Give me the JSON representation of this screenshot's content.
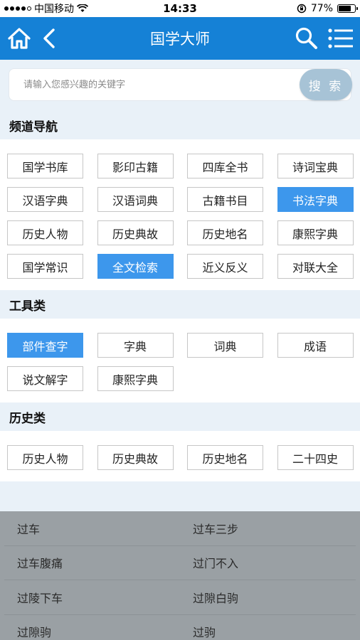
{
  "status_bar": {
    "carrier": "中国移动",
    "time": "14:33",
    "battery_text": "77%",
    "battery_level": 0.77
  },
  "header": {
    "title": "国学大师"
  },
  "search": {
    "placeholder": "请输入您感兴趣的关键字",
    "button_label": "搜 索"
  },
  "sections": [
    {
      "title": "频道导航",
      "items": [
        {
          "label": "国学书库",
          "active": false
        },
        {
          "label": "影印古籍",
          "active": false
        },
        {
          "label": "四库全书",
          "active": false
        },
        {
          "label": "诗词宝典",
          "active": false
        },
        {
          "label": "汉语字典",
          "active": false
        },
        {
          "label": "汉语词典",
          "active": false
        },
        {
          "label": "古籍书目",
          "active": false
        },
        {
          "label": "书法字典",
          "active": true
        },
        {
          "label": "历史人物",
          "active": false
        },
        {
          "label": "历史典故",
          "active": false
        },
        {
          "label": "历史地名",
          "active": false
        },
        {
          "label": "康熙字典",
          "active": false
        },
        {
          "label": "国学常识",
          "active": false
        },
        {
          "label": "全文检索",
          "active": true
        },
        {
          "label": "近义反义",
          "active": false
        },
        {
          "label": "对联大全",
          "active": false
        }
      ]
    },
    {
      "title": "工具类",
      "items": [
        {
          "label": "部件查字",
          "active": true
        },
        {
          "label": "字典",
          "active": false
        },
        {
          "label": "词典",
          "active": false
        },
        {
          "label": "成语",
          "active": false
        },
        {
          "label": "说文解字",
          "active": false
        },
        {
          "label": "康熙字典",
          "active": false
        }
      ]
    },
    {
      "title": "历史类",
      "items": [
        {
          "label": "历史人物",
          "active": false
        },
        {
          "label": "历史典故",
          "active": false
        },
        {
          "label": "历史地名",
          "active": false
        },
        {
          "label": "二十四史",
          "active": false
        }
      ]
    }
  ],
  "suggestions": [
    [
      "过车",
      "过车三步"
    ],
    [
      "过车腹痛",
      "过门不入"
    ],
    [
      "过陵下车",
      "过隙白驹"
    ],
    [
      "过隙驹",
      "过驹"
    ]
  ],
  "colors": {
    "header_bg": "#1581d6",
    "active_tag": "#3d97ec",
    "page_bg": "#e9f1f8"
  }
}
